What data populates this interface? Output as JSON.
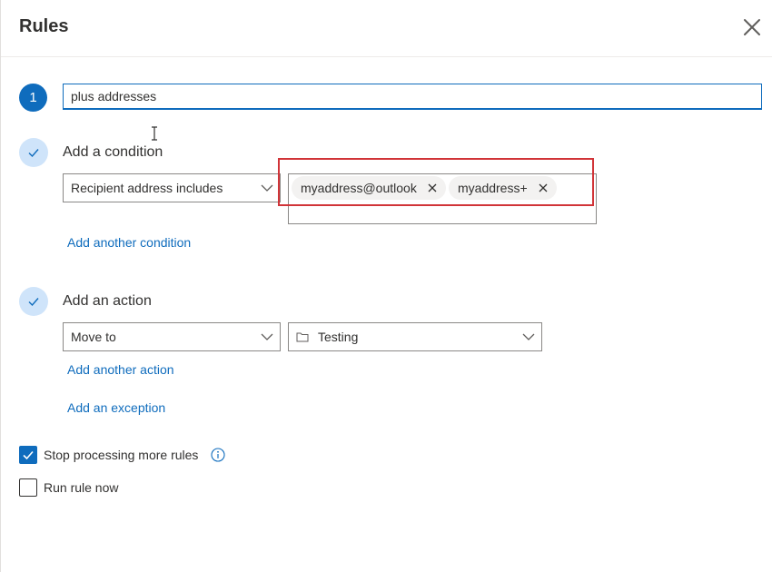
{
  "dialog": {
    "title": "Rules"
  },
  "rule": {
    "step_number": "1",
    "name_value": "plus addresses"
  },
  "condition": {
    "label": "Add a condition",
    "field_selected": "Recipient address includes",
    "chips": [
      "myaddress@outlook",
      "myaddress+"
    ],
    "add_link": "Add another condition"
  },
  "action": {
    "label": "Add an action",
    "type_selected": "Move to",
    "folder_selected": "Testing",
    "add_link": "Add another action",
    "exception_link": "Add an exception"
  },
  "options": {
    "stop_processing_label": "Stop processing more rules",
    "stop_processing_checked": true,
    "run_now_label": "Run rule now",
    "run_now_checked": false
  },
  "colors": {
    "accent": "#0f6cbd",
    "highlight": "#d13438",
    "check_bg": "#cfe4fa"
  }
}
